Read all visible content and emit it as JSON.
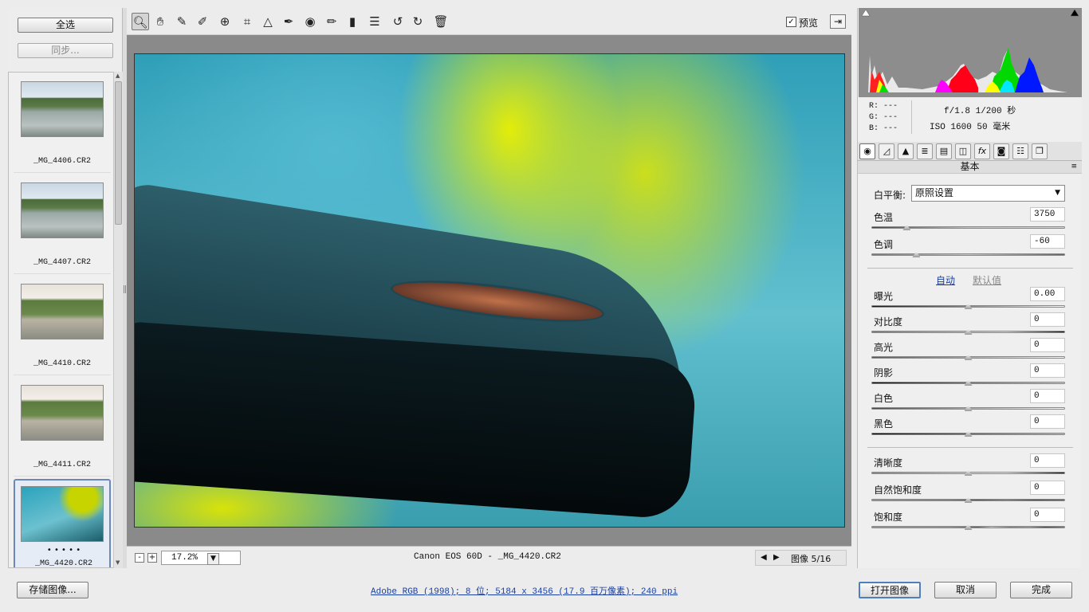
{
  "filmstrip": {
    "select_all_label": "全选",
    "sync_label": "同步...",
    "items": [
      {
        "name": "_MG_4406.CR2"
      },
      {
        "name": "_MG_4407.CR2"
      },
      {
        "name": "_MG_4410.CR2"
      },
      {
        "name": "_MG_4411.CR2"
      },
      {
        "name": "_MG_4420.CR2",
        "rating": "• • • • •",
        "selected": true
      }
    ]
  },
  "toolbar": {
    "tools": [
      "zoom-icon",
      "hand-icon",
      "white-balance-icon",
      "color-sampler-icon",
      "target-adjust-icon",
      "crop-icon",
      "straighten-icon",
      "spot-removal-icon",
      "red-eye-icon",
      "adjustment-brush-icon",
      "graduated-filter-icon",
      "preferences-icon",
      "rotate-left-icon",
      "rotate-right-icon",
      "trash-icon"
    ],
    "preview_label": "预览",
    "preview_checked": true
  },
  "statusbar": {
    "zoom_out": "-",
    "zoom_in": "+",
    "zoom_value": "17.2%",
    "camera_info": "Canon EOS 60D -   _MG_4420.CR2",
    "image_counter": "图像 5/16"
  },
  "readout": {
    "r": "R:  ---",
    "g": "G:  ---",
    "b": "B:  ---",
    "aperture_shutter": "f/1.8   1/200 秒",
    "iso_focal": "ISO 1600   50 毫米"
  },
  "panel": {
    "title": "基本",
    "white_balance_label": "白平衡:",
    "white_balance_value": "原照设置",
    "auto_label": "自动",
    "default_label": "默认值",
    "sliders": [
      {
        "key": "temperature",
        "label": "色温",
        "value": "3750",
        "level": 0.18
      },
      {
        "key": "tint",
        "label": "色调",
        "value": "-60",
        "level": 0.23
      },
      {
        "key": "exposure",
        "label": "曝光",
        "value": "0.00",
        "level": 0.5
      },
      {
        "key": "contrast",
        "label": "对比度",
        "value": "0",
        "level": 0.5
      },
      {
        "key": "highlights",
        "label": "高光",
        "value": "0",
        "level": 0.5
      },
      {
        "key": "shadows",
        "label": "阴影",
        "value": "0",
        "level": 0.5
      },
      {
        "key": "whites",
        "label": "白色",
        "value": "0",
        "level": 0.5
      },
      {
        "key": "blacks",
        "label": "黑色",
        "value": "0",
        "level": 0.5
      },
      {
        "key": "clarity",
        "label": "清晰度",
        "value": "0",
        "level": 0.5
      },
      {
        "key": "vibrance",
        "label": "自然饱和度",
        "value": "0",
        "level": 0.5
      },
      {
        "key": "saturation",
        "label": "饱和度",
        "value": "0",
        "level": 0.5
      }
    ]
  },
  "bottom": {
    "save_label": "存储图像...",
    "workflow_info": "Adobe RGB (1998); 8 位; 5184 x 3456 (17.9 百万像素); 240 ppi",
    "open_label": "打开图像",
    "cancel_label": "取消",
    "done_label": "完成"
  },
  "colors": {
    "accent": "#1a3fa0",
    "histogram_bg": "#8d8d8d"
  }
}
